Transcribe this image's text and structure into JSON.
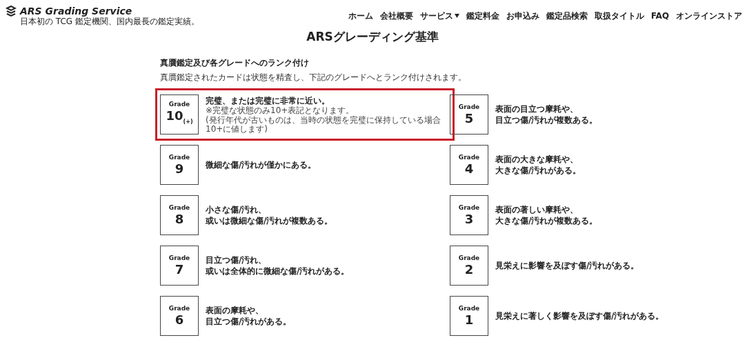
{
  "header": {
    "logo_text": "ARS Grading Service",
    "tagline": "日本初の TCG 鑑定機関、国内最長の鑑定実績。"
  },
  "nav": [
    {
      "label": "ホーム",
      "dropdown": false
    },
    {
      "label": "会社概要",
      "dropdown": false
    },
    {
      "label": "サービス",
      "dropdown": true
    },
    {
      "label": "鑑定料金",
      "dropdown": false
    },
    {
      "label": "お申込み",
      "dropdown": false
    },
    {
      "label": "鑑定品検索",
      "dropdown": false
    },
    {
      "label": "取扱タイトル",
      "dropdown": false
    },
    {
      "label": "FAQ",
      "dropdown": false
    },
    {
      "label": "オンラインストア",
      "dropdown": false
    }
  ],
  "page_title": "ARSグレーディング基準",
  "section": {
    "heading": "真贋鑑定及び各グレードへのランク付け",
    "description": "真贋鑑定されたカードは状態を精査し、下記のグレードへとランク付けされます。"
  },
  "grades": [
    {
      "label": "Grade",
      "value": "10$_{(+)}$",
      "description": [
        "完璧、または完璧に非常に近い。"
      ],
      "notes": [
        "※完璧な状態のみ10+表記となります。",
        "(発行年代が古いものは、当時の状態を完璧に保持している場合10+に値します)"
      ],
      "highlighted": true
    },
    {
      "label": "Grade",
      "value": "9",
      "description": [
        "微細な傷/汚れが僅かにある。"
      ],
      "highlighted": false
    },
    {
      "label": "Grade",
      "value": "8",
      "description": [
        "小さな傷/汚れ、",
        "或いは微細な傷/汚れが複数ある。"
      ],
      "highlighted": false
    },
    {
      "label": "Grade",
      "value": "7",
      "description": [
        "目立つ傷/汚れ、",
        "或いは全体的に微細な傷/汚れがある。"
      ],
      "highlighted": false
    },
    {
      "label": "Grade",
      "value": "6",
      "description": [
        "表面の摩耗や、",
        "目立つ傷/汚れがある。"
      ],
      "highlighted": false
    },
    {
      "label": "Grade",
      "value": "5",
      "description": [
        "表面の目立つ摩耗や、",
        "目立つ傷/汚れが複数ある。"
      ],
      "highlighted": false
    },
    {
      "label": "Grade",
      "value": "4",
      "description": [
        "表面の大きな摩耗や、",
        "大きな傷/汚れがある。"
      ],
      "highlighted": false
    },
    {
      "label": "Grade",
      "value": "3",
      "description": [
        "表面の著しい摩耗や、",
        "大きな傷/汚れが複数ある。"
      ],
      "highlighted": false
    },
    {
      "label": "Grade",
      "value": "2",
      "description": [
        "見栄えに影響を及ぼす傷/汚れがある。"
      ],
      "highlighted": false
    },
    {
      "label": "Grade",
      "value": "1",
      "description": [
        "見栄えに著しく影響を及ぼす傷/汚れがある。"
      ],
      "highlighted": false
    }
  ]
}
